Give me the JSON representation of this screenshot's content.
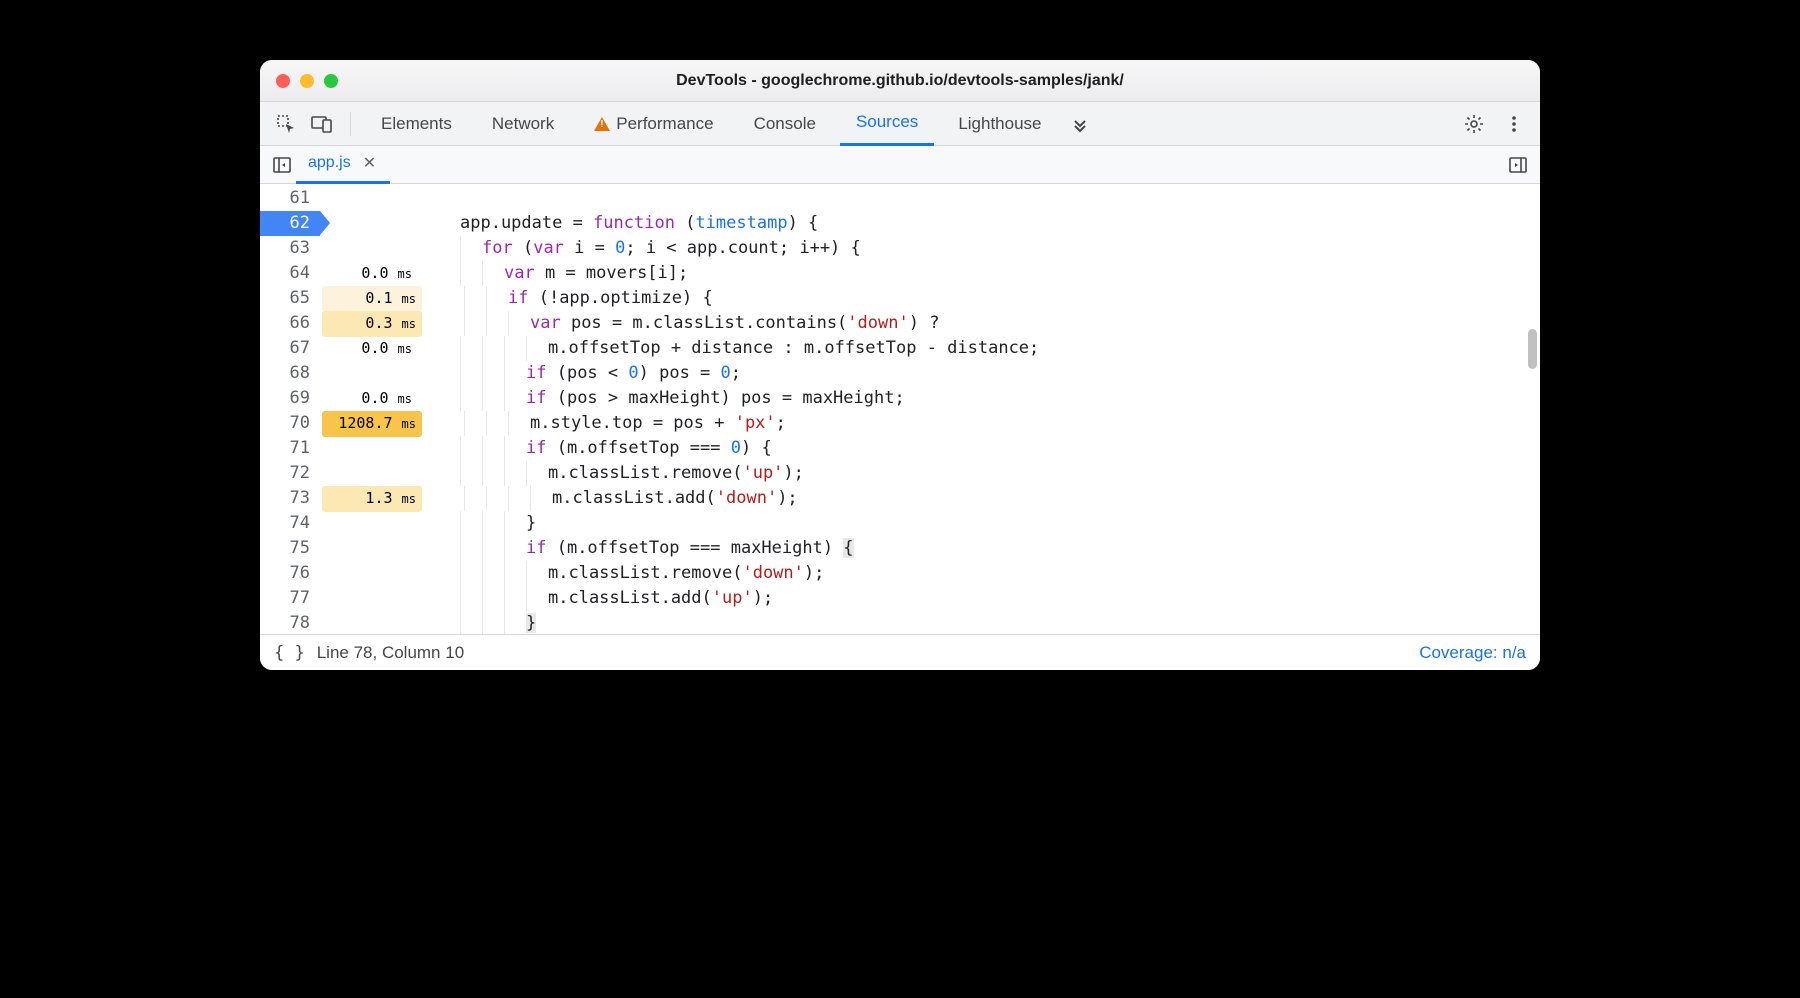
{
  "window": {
    "title": "DevTools - googlechrome.github.io/devtools-samples/jank/"
  },
  "tabs": {
    "elements": "Elements",
    "network": "Network",
    "performance": "Performance",
    "console": "Console",
    "sources": "Sources",
    "lighthouse": "Lighthouse"
  },
  "filetab": {
    "name": "app.js"
  },
  "status": {
    "cursor": "Line 78, Column 10",
    "coverage": "Coverage: n/a"
  },
  "lines": [
    {
      "n": "61",
      "timing": "",
      "tlevel": "",
      "bp": false,
      "ind": 0,
      "html": ""
    },
    {
      "n": "62",
      "timing": "",
      "tlevel": "",
      "bp": true,
      "ind": 0,
      "html": "app.update = <span class='fn'>function</span> (<span class='param'>timestamp</span>) {"
    },
    {
      "n": "63",
      "timing": "",
      "tlevel": "",
      "bp": false,
      "ind": 1,
      "html": "<span class='kw'>for</span> (<span class='kw'>var</span> i = <span class='num'>0</span>; i &lt; app.count; i++) {"
    },
    {
      "n": "64",
      "timing": "0.0",
      "tlevel": "t0",
      "bp": false,
      "ind": 2,
      "html": "<span class='kw'>var</span> m = movers[i];"
    },
    {
      "n": "65",
      "timing": "0.1",
      "tlevel": "t1",
      "bp": false,
      "ind": 2,
      "html": "<span class='kw'>if</span> (!app.optimize) {"
    },
    {
      "n": "66",
      "timing": "0.3",
      "tlevel": "t2",
      "bp": false,
      "ind": 3,
      "html": "<span class='kw'>var</span> pos = m.classList.contains(<span class='str'>'down'</span>) ?"
    },
    {
      "n": "67",
      "timing": "0.0",
      "tlevel": "t0",
      "bp": false,
      "ind": 4,
      "html": "m.offsetTop + distance : m.offsetTop - distance;"
    },
    {
      "n": "68",
      "timing": "",
      "tlevel": "",
      "bp": false,
      "ind": 3,
      "html": "<span class='kw'>if</span> (pos &lt; <span class='num'>0</span>) pos = <span class='num'>0</span>;"
    },
    {
      "n": "69",
      "timing": "0.0",
      "tlevel": "t0",
      "bp": false,
      "ind": 3,
      "html": "<span class='kw'>if</span> (pos &gt; maxHeight) pos = maxHeight;"
    },
    {
      "n": "70",
      "timing": "1208.7",
      "tlevel": "t3",
      "bp": false,
      "ind": 3,
      "html": "m.style.top = pos + <span class='str'>'px'</span>;"
    },
    {
      "n": "71",
      "timing": "",
      "tlevel": "",
      "bp": false,
      "ind": 3,
      "html": "<span class='kw'>if</span> (m.offsetTop === <span class='num'>0</span>) {"
    },
    {
      "n": "72",
      "timing": "",
      "tlevel": "",
      "bp": false,
      "ind": 4,
      "html": "m.classList.remove(<span class='str'>'up'</span>);"
    },
    {
      "n": "73",
      "timing": "1.3",
      "tlevel": "t2",
      "bp": false,
      "ind": 4,
      "html": "m.classList.add(<span class='str'>'down'</span>);"
    },
    {
      "n": "74",
      "timing": "",
      "tlevel": "",
      "bp": false,
      "ind": 3,
      "html": "}"
    },
    {
      "n": "75",
      "timing": "",
      "tlevel": "",
      "bp": false,
      "ind": 3,
      "html": "<span class='kw'>if</span> (m.offsetTop === maxHeight) <span class='hl-brace'>{</span>"
    },
    {
      "n": "76",
      "timing": "",
      "tlevel": "",
      "bp": false,
      "ind": 4,
      "html": "m.classList.remove(<span class='str'>'down'</span>);"
    },
    {
      "n": "77",
      "timing": "",
      "tlevel": "",
      "bp": false,
      "ind": 4,
      "html": "m.classList.add(<span class='str'>'up'</span>);"
    },
    {
      "n": "78",
      "timing": "",
      "tlevel": "",
      "bp": false,
      "ind": 3,
      "html": "<span class='hl-brace'>}</span>"
    }
  ]
}
